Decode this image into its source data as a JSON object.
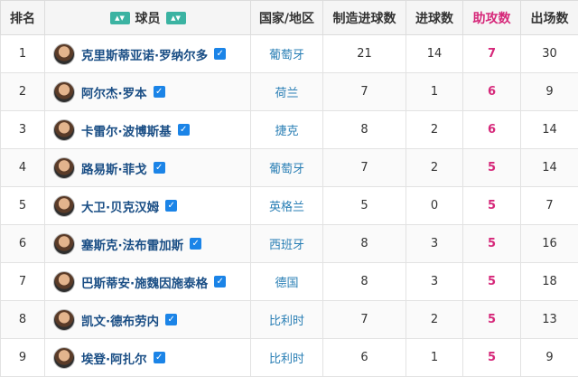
{
  "headers": {
    "rank": "排名",
    "player": "球员",
    "country": "国家/地区",
    "created": "制造进球数",
    "goals": "进球数",
    "assists": "助攻数",
    "apps": "出场数"
  },
  "colors": {
    "assist_accent": "#d6287a",
    "country_link": "#2a7fb5",
    "player_link": "#1a4e85",
    "verified_check": "#1b84e7",
    "header_icon": "#3bb3a2"
  },
  "icons": {
    "header_left": "sort-icon",
    "header_right": "sort-icon",
    "verified": "checkbox-checked-icon"
  },
  "rows": [
    {
      "rank": "1",
      "name": "克里斯蒂亚诺·罗纳尔多",
      "country": "葡萄牙",
      "created": "21",
      "goals": "14",
      "assists": "7",
      "apps": "30"
    },
    {
      "rank": "2",
      "name": "阿尔杰·罗本",
      "country": "荷兰",
      "created": "7",
      "goals": "1",
      "assists": "6",
      "apps": "9"
    },
    {
      "rank": "3",
      "name": "卡雷尔·波博斯基",
      "country": "捷克",
      "created": "8",
      "goals": "2",
      "assists": "6",
      "apps": "14"
    },
    {
      "rank": "4",
      "name": "路易斯·菲戈",
      "country": "葡萄牙",
      "created": "7",
      "goals": "2",
      "assists": "5",
      "apps": "14"
    },
    {
      "rank": "5",
      "name": "大卫·贝克汉姆",
      "country": "英格兰",
      "created": "5",
      "goals": "0",
      "assists": "5",
      "apps": "7"
    },
    {
      "rank": "6",
      "name": "塞斯克·法布雷加斯",
      "country": "西班牙",
      "created": "8",
      "goals": "3",
      "assists": "5",
      "apps": "16"
    },
    {
      "rank": "7",
      "name": "巴斯蒂安·施魏因施泰格",
      "country": "德国",
      "created": "8",
      "goals": "3",
      "assists": "5",
      "apps": "18"
    },
    {
      "rank": "8",
      "name": "凯文·德布劳内",
      "country": "比利时",
      "created": "7",
      "goals": "2",
      "assists": "5",
      "apps": "13"
    },
    {
      "rank": "9",
      "name": "埃登·阿扎尔",
      "country": "比利时",
      "created": "6",
      "goals": "1",
      "assists": "5",
      "apps": "9"
    }
  ]
}
